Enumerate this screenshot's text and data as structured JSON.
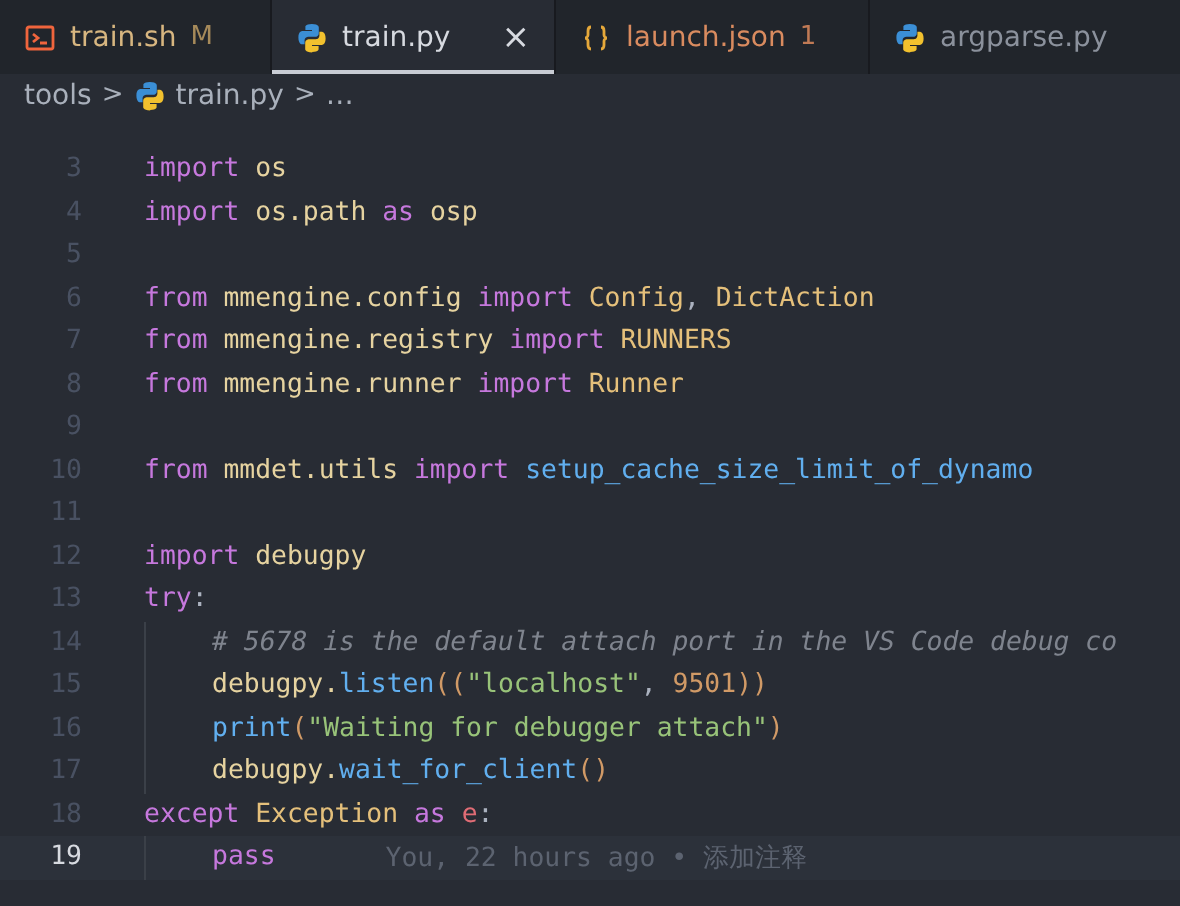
{
  "tabs": [
    {
      "kind": "shell",
      "label": "train.sh",
      "color": "#d7b680",
      "badge": "M",
      "selected": false
    },
    {
      "kind": "python",
      "label": "train.py",
      "color": "#d7dae0",
      "close": "×",
      "selected": true
    },
    {
      "kind": "json",
      "label": "launch.json",
      "color": "#d98b5f",
      "badge": "1",
      "selected": false
    },
    {
      "kind": "python",
      "label": "argparse.py",
      "color": "#8b919c",
      "selected": false
    }
  ],
  "breadcrumb": [
    {
      "label": "tools",
      "icon": false
    },
    {
      "label": "train.py",
      "icon": true
    },
    {
      "label": "…",
      "icon": false
    }
  ],
  "separator": ">",
  "lines": [
    {
      "number": "3",
      "indented": false,
      "current": false,
      "tokens": [
        {
          "kind": "keyword",
          "text": "import "
        },
        {
          "kind": "module",
          "text": "os"
        }
      ]
    },
    {
      "number": "4",
      "indented": false,
      "current": false,
      "tokens": [
        {
          "kind": "keyword",
          "text": "import "
        },
        {
          "kind": "module",
          "text": "os.path "
        },
        {
          "kind": "keyword",
          "text": "as "
        },
        {
          "kind": "module",
          "text": "osp"
        }
      ]
    },
    {
      "number": "5",
      "indented": false,
      "current": false
    },
    {
      "number": "6",
      "indented": false,
      "current": false,
      "tokens": [
        {
          "kind": "keyword",
          "text": "from "
        },
        {
          "kind": "module",
          "text": "mmengine.config "
        },
        {
          "kind": "keyword",
          "text": "import "
        },
        {
          "kind": "class",
          "text": "Config"
        },
        {
          "kind": "plain",
          "text": ", "
        },
        {
          "kind": "class",
          "text": "DictAction"
        }
      ]
    },
    {
      "number": "7",
      "indented": false,
      "current": false,
      "tokens": [
        {
          "kind": "keyword",
          "text": "from "
        },
        {
          "kind": "module",
          "text": "mmengine.registry "
        },
        {
          "kind": "keyword",
          "text": "import "
        },
        {
          "kind": "class",
          "text": "RUNNERS"
        }
      ]
    },
    {
      "number": "8",
      "indented": false,
      "current": false,
      "tokens": [
        {
          "kind": "keyword",
          "text": "from "
        },
        {
          "kind": "module",
          "text": "mmengine.runner "
        },
        {
          "kind": "keyword",
          "text": "import "
        },
        {
          "kind": "class",
          "text": "Runner"
        }
      ]
    },
    {
      "number": "9",
      "indented": false,
      "current": false
    },
    {
      "number": "10",
      "indented": false,
      "current": false,
      "tokens": [
        {
          "kind": "keyword",
          "text": "from "
        },
        {
          "kind": "module",
          "text": "mmdet.utils "
        },
        {
          "kind": "keyword",
          "text": "import "
        },
        {
          "kind": "function",
          "text": "setup_cache_size_limit_of_dynamo"
        }
      ]
    },
    {
      "number": "11",
      "indented": false,
      "current": false
    },
    {
      "number": "12",
      "indented": false,
      "current": false,
      "tokens": [
        {
          "kind": "keyword",
          "text": "import "
        },
        {
          "kind": "module",
          "text": "debugpy"
        }
      ]
    },
    {
      "number": "13",
      "indented": false,
      "current": false,
      "tokens": [
        {
          "kind": "keyword",
          "text": "try"
        },
        {
          "kind": "plain",
          "text": ":"
        }
      ]
    },
    {
      "number": "14",
      "indented": true,
      "current": false,
      "tokens": [
        {
          "kind": "comment",
          "text": "# 5678 is the default attach port in the VS Code debug co"
        }
      ]
    },
    {
      "number": "15",
      "indented": true,
      "current": false,
      "tokens": [
        {
          "kind": "module",
          "text": "debugpy."
        },
        {
          "kind": "function",
          "text": "listen"
        },
        {
          "kind": "bracket",
          "text": "(("
        },
        {
          "kind": "string",
          "text": "\"localhost\""
        },
        {
          "kind": "plain",
          "text": ", "
        },
        {
          "kind": "number",
          "text": "9501"
        },
        {
          "kind": "bracket",
          "text": "))"
        }
      ]
    },
    {
      "number": "16",
      "indented": true,
      "current": false,
      "tokens": [
        {
          "kind": "function",
          "text": "print"
        },
        {
          "kind": "bracket",
          "text": "("
        },
        {
          "kind": "string",
          "text": "\"Waiting for debugger attach\""
        },
        {
          "kind": "bracket",
          "text": ")"
        }
      ]
    },
    {
      "number": "17",
      "indented": true,
      "current": false,
      "tokens": [
        {
          "kind": "module",
          "text": "debugpy."
        },
        {
          "kind": "function",
          "text": "wait_for_client"
        },
        {
          "kind": "bracket",
          "text": "()"
        }
      ]
    },
    {
      "number": "18",
      "indented": false,
      "current": false,
      "tokens": [
        {
          "kind": "keyword",
          "text": "except "
        },
        {
          "kind": "class",
          "text": "Exception "
        },
        {
          "kind": "keyword",
          "text": "as "
        },
        {
          "kind": "variable",
          "text": "e"
        },
        {
          "kind": "plain",
          "text": ":"
        }
      ]
    },
    {
      "number": "19",
      "indented": true,
      "current": true,
      "tokens": [
        {
          "kind": "keyword",
          "text": "pass"
        }
      ],
      "blame": "You, 22 hours ago • 添加注释"
    }
  ]
}
